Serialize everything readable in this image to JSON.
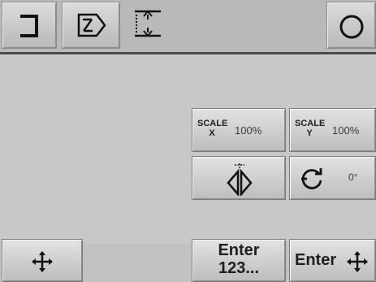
{
  "toolbar": {
    "items": [
      {
        "icon": "bracket-icon"
      },
      {
        "icon": "page-arrow-icon"
      },
      {
        "icon": "vertical-dimension-icon"
      },
      {
        "icon": "circle-icon"
      }
    ]
  },
  "transform": {
    "scale_x": {
      "title": "SCALE",
      "axis": "X",
      "value": "100%"
    },
    "scale_y": {
      "title": "SCALE",
      "axis": "Y",
      "value": "100%"
    },
    "mirror": {
      "icon": "mirror-icon"
    },
    "rotate": {
      "icon": "rotate-icon",
      "value": "0°"
    }
  },
  "bottom": {
    "move": {
      "icon": "move-arrows-icon"
    },
    "enter_numeric": {
      "line1": "Enter",
      "line2": "123..."
    },
    "enter_move": {
      "label": "Enter",
      "icon": "move-arrows-icon"
    }
  }
}
